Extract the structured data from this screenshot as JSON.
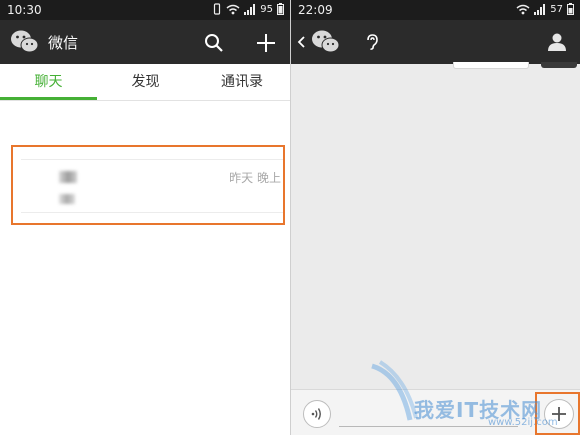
{
  "left": {
    "status": {
      "time": "10:30",
      "battery": "95"
    },
    "app_title": "微信",
    "tabs": [
      {
        "label": "聊天",
        "active": true
      },
      {
        "label": "发现",
        "active": false
      },
      {
        "label": "通讯录",
        "active": false
      }
    ],
    "chat": {
      "name": "",
      "preview": "",
      "time": "昨天 晚上"
    },
    "accent_color": "#45b035",
    "highlight_color": "#e8762d"
  },
  "right": {
    "status": {
      "time": "22:09",
      "battery": "57"
    }
  },
  "watermark": {
    "text": "我爱IT技术网",
    "url": "www.52ij.com"
  },
  "icons": [
    "wechat-logo-icon",
    "search-icon",
    "plus-icon",
    "back-chevron-icon",
    "earpiece-icon",
    "person-icon",
    "voice-icon",
    "signal-icon",
    "wifi-icon",
    "battery-icon"
  ]
}
